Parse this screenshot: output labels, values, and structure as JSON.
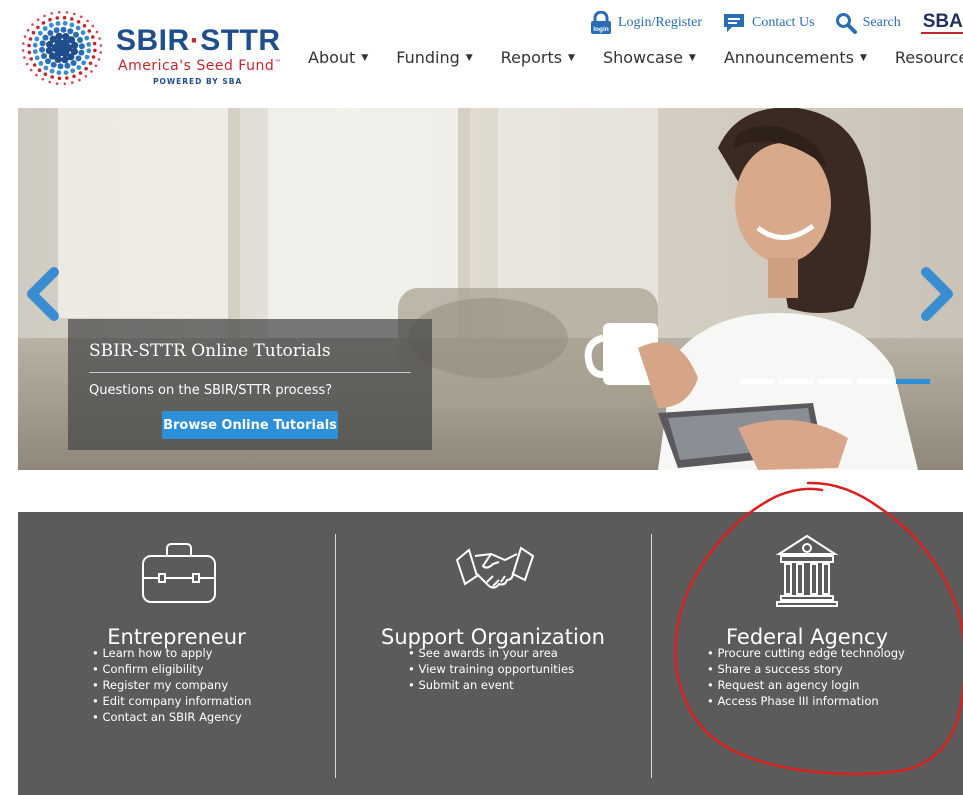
{
  "logo": {
    "title_left": "SBIR",
    "title_dot": "·",
    "title_right": "STTR",
    "subtitle": "America's Seed Fund",
    "tm": "™",
    "powered": "POWERED BY SBA"
  },
  "utility": {
    "login_badge": "login",
    "login_label": "Login/Register",
    "contact_label": "Contact Us",
    "search_label": "Search",
    "sba_label": "SBA"
  },
  "nav": {
    "items": [
      {
        "label": "About"
      },
      {
        "label": "Funding"
      },
      {
        "label": "Reports"
      },
      {
        "label": "Showcase"
      },
      {
        "label": "Announcements"
      },
      {
        "label": "Resources"
      }
    ],
    "caret": "▼"
  },
  "carousel": {
    "caption_title": "SBIR-STTR Online Tutorials",
    "caption_text": "Questions on the SBIR/STTR process?",
    "button_label": "Browse Online Tutorials",
    "slide_count": 5,
    "active_slide": 5
  },
  "audiences": [
    {
      "title": "Entrepreneur",
      "icon": "briefcase-icon",
      "items": [
        "Learn how to apply",
        "Confirm eligibility",
        "Register my company",
        "Edit company information",
        "Contact an SBIR Agency"
      ]
    },
    {
      "title": "Support Organization",
      "icon": "handshake-icon",
      "items": [
        "See awards in your area",
        "View training opportunities",
        "Submit an event"
      ]
    },
    {
      "title": "Federal Agency",
      "icon": "government-building-icon",
      "items": [
        "Procure cutting edge technology",
        "Share a success story",
        "Request an agency login",
        "Access Phase III information"
      ]
    }
  ],
  "colors": {
    "brand_blue": "#1f4e8c",
    "brand_red": "#c1272d",
    "link_blue": "#2a6db5",
    "accent_blue": "#2d8fd8",
    "panel_gray": "#5b5b5b",
    "annotation_red": "#d8201c"
  }
}
